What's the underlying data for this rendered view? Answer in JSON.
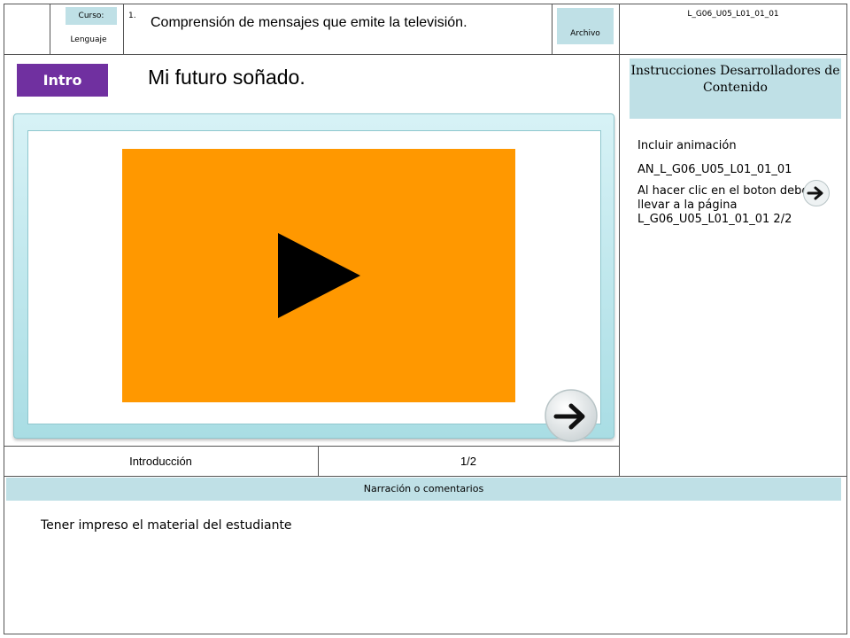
{
  "header": {
    "course_label": "Curso:",
    "course_name": "Lenguaje",
    "item_number": "1.",
    "title": "Comprensión de mensajes que emite la televisión.",
    "file_label": "Archivo",
    "code": "L_G06_U05_L01_01_01"
  },
  "slide": {
    "badge": "Intro",
    "title": "Mi futuro soñado.",
    "video_color": "#ff9800",
    "next_icon": "arrow-right-icon"
  },
  "footer": {
    "section": "Introducción",
    "page": "1/2"
  },
  "instructions": {
    "heading": "Instrucciones Desarrolladores de Contenido",
    "note1": "Incluir animación",
    "note2": "AN_L_G06_U05_L01_01_01",
    "note3": "Al hacer clic en el boton debe llevar a la página L_G06_U05_L01_01_01 2/2"
  },
  "narration": {
    "heading": "Narración o comentarios",
    "text": "Tener impreso el material del estudiante"
  },
  "colors": {
    "accent_panel": "#bfe0e6",
    "badge": "#7030a0"
  }
}
